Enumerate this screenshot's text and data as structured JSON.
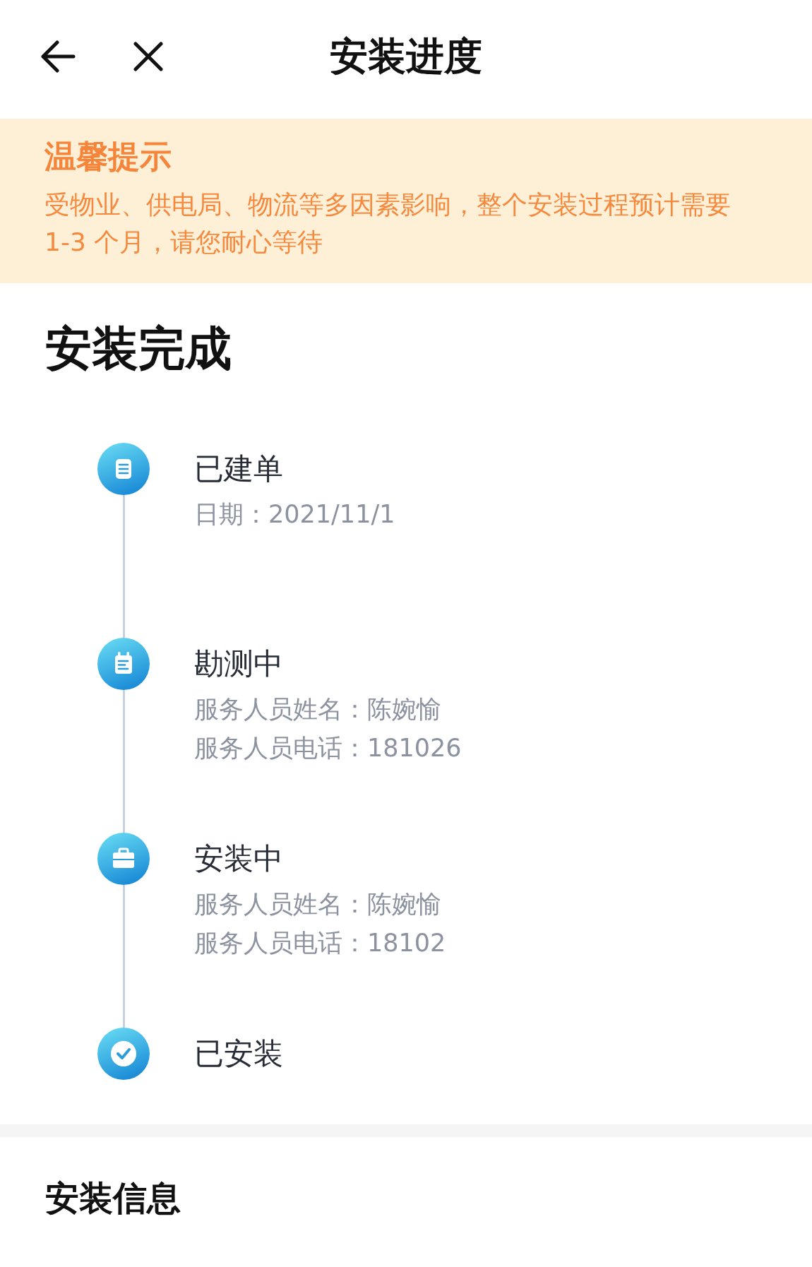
{
  "header": {
    "title": "安装进度"
  },
  "notice": {
    "title": "温馨提示",
    "text": "受物业、供电局、物流等多因素影响，整个安装过程预计需要1-3 个月，请您耐心等待"
  },
  "progress": {
    "heading": "安装完成",
    "steps": [
      {
        "kind": "order",
        "title": "已建单",
        "details": [
          "日期：2021/11/1"
        ]
      },
      {
        "kind": "survey",
        "title": "勘测中",
        "details": [
          "服务人员姓名：陈婉愉",
          "服务人员电话：181026"
        ]
      },
      {
        "kind": "install",
        "title": "安装中",
        "details": [
          "服务人员姓名：陈婉愉",
          "服务人员电话：18102"
        ]
      },
      {
        "kind": "done",
        "title": "已安装"
      }
    ]
  },
  "info": {
    "heading": "安装信息"
  }
}
